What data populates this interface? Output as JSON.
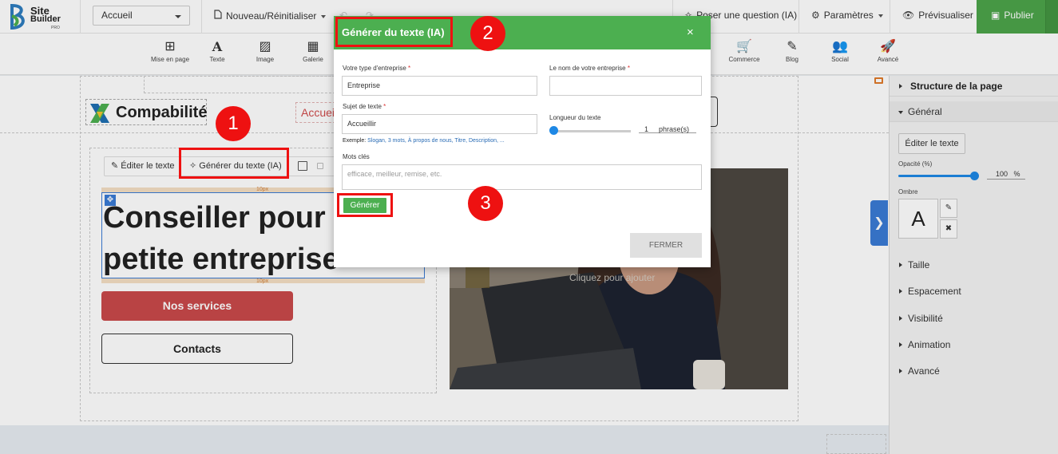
{
  "topbar": {
    "logo_line1": "Site",
    "logo_line2": "Builder",
    "logo_line3": "PRO",
    "page_selector": "Accueil",
    "new_reset": "Nouveau/Réinitialiser",
    "ask_question": "Poser une question (IA)",
    "settings": "Paramètres",
    "preview": "Prévisualiser",
    "publish": "Publier"
  },
  "tools": [
    {
      "label": "Mise en page",
      "icon": "layout-icon"
    },
    {
      "label": "Texte",
      "icon": "text-icon"
    },
    {
      "label": "Image",
      "icon": "image-icon"
    },
    {
      "label": "Galerie",
      "icon": "gallery-icon"
    },
    {
      "label": "Commerce",
      "icon": "cart-icon"
    },
    {
      "label": "Blog",
      "icon": "edit-icon"
    },
    {
      "label": "Social",
      "icon": "users-icon"
    },
    {
      "label": "Avancé",
      "icon": "rocket-icon"
    }
  ],
  "canvas": {
    "brand": "Compabilité",
    "nav_link": "Accueil",
    "edit_text": "Éditer le texte",
    "generate_ai": "Générer du texte (IA)",
    "heading_line1": "Conseiller pour",
    "heading_line2": "petite entreprise",
    "padding_label": "10px",
    "btn_services": "Nos services",
    "btn_contacts": "Contacts",
    "photo_hint": "Cliquez pour ajouter"
  },
  "panel": {
    "title": "Structure de la page",
    "section_general": "Général",
    "edit_text_btn": "Éditer le texte",
    "opacity_label": "Opacité (%)",
    "opacity_value": "100",
    "opacity_unit": "%",
    "opacity_level": 100,
    "shadow_label": "Ombre",
    "shadow_preview": "A",
    "sections": [
      "Taille",
      "Espacement",
      "Visibilité",
      "Animation",
      "Avancé"
    ]
  },
  "modal": {
    "title": "Générer du texte (IA)",
    "close": "×",
    "business_type_label": "Votre type d'entreprise",
    "business_type_value": "Entreprise",
    "business_name_label": "Le nom de votre entreprise",
    "business_name_value": "",
    "subject_label": "Sujet de texte",
    "subject_value": "Accueillir",
    "length_label": "Longueur du texte",
    "length_value": "1",
    "length_unit": "phrase(s)",
    "example_prefix": "Exemple:",
    "example_links": "Slogan, 3 mots, À propos de nous, Titre, Description, ...",
    "keywords_label": "Mots clés",
    "keywords_placeholder": "efficace, meilleur, remise, etc.",
    "generate_btn": "Générer",
    "close_btn": "FERMER",
    "required_mark": "*"
  },
  "annotations": [
    "1",
    "2",
    "3"
  ],
  "colors": {
    "modal_header": "#4caf50",
    "publish": "#4ca44a",
    "accent_blue": "#1e88e5",
    "marker_red": "#ee1111",
    "services_btn": "#c9494a"
  }
}
